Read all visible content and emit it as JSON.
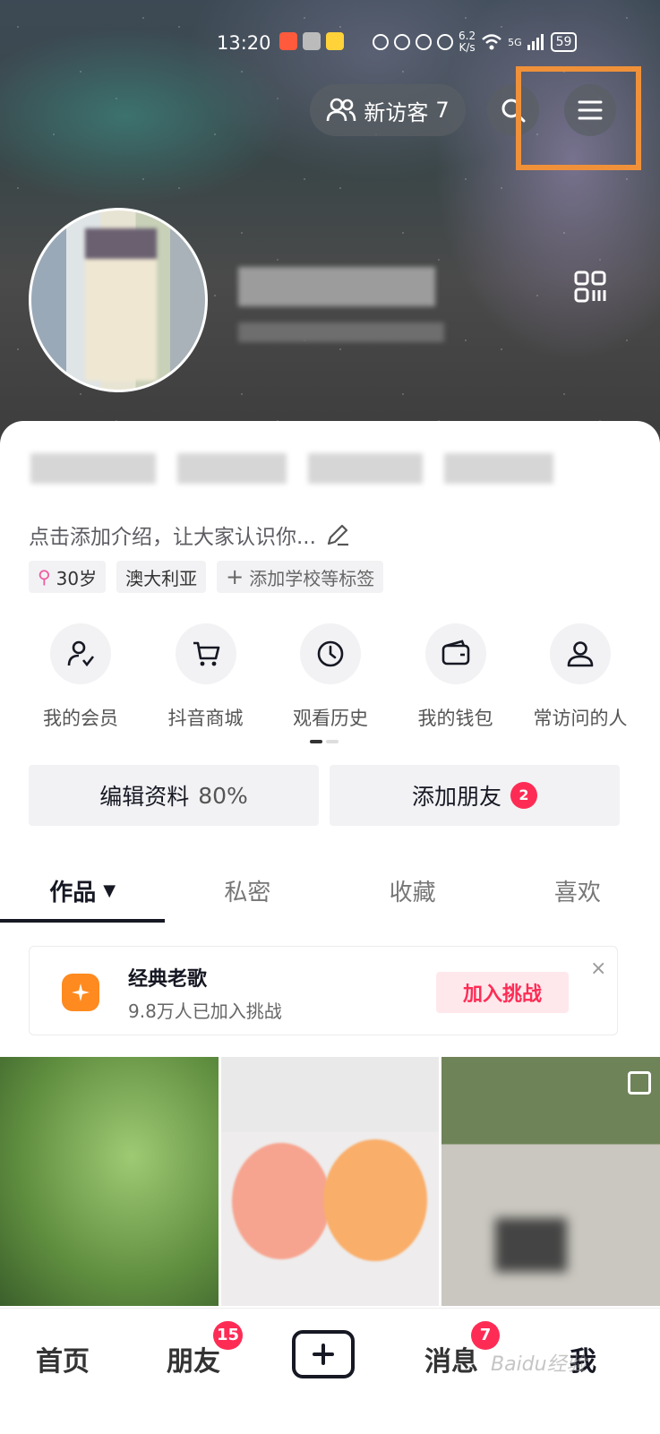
{
  "status_bar": {
    "time": "13:20",
    "net_speed_value": "6.2",
    "net_speed_unit": "K/s",
    "signal_label": "5G",
    "battery": "59"
  },
  "header": {
    "visitor_label": "新访客",
    "visitor_count": "7",
    "search_icon": "search-icon",
    "menu_icon": "menu-icon",
    "highlight_color": "#f0913a"
  },
  "profile": {
    "intro": "点击添加介绍，让大家认识你...",
    "tags": [
      {
        "text": "30岁",
        "icon": "female-icon"
      },
      {
        "text": "澳大利亚"
      },
      {
        "text": "添加学校等标签",
        "icon": "plus-icon"
      }
    ]
  },
  "shortcuts": [
    {
      "label": "我的会员",
      "icon": "member-icon"
    },
    {
      "label": "抖音商城",
      "icon": "cart-icon"
    },
    {
      "label": "观看历史",
      "icon": "clock-icon"
    },
    {
      "label": "我的钱包",
      "icon": "wallet-icon"
    },
    {
      "label": "常访问的人",
      "icon": "person-icon"
    }
  ],
  "actions": {
    "edit_label": "编辑资料",
    "edit_progress": "80%",
    "add_friend_label": "添加朋友",
    "add_friend_badge": "2"
  },
  "tabs": [
    "作品",
    "私密",
    "收藏",
    "喜欢"
  ],
  "challenge": {
    "title": "经典老歌",
    "subtitle": "9.8万人已加入挑战",
    "button": "加入挑战",
    "close": "×"
  },
  "bottom_nav": {
    "home": "首页",
    "friends": "朋友",
    "friends_badge": "15",
    "messages": "消息",
    "messages_badge": "7",
    "me": "我"
  },
  "watermark": "Baidu经验",
  "colors": {
    "accent": "#fe2c55",
    "challenge_logo": "#ff8a1f"
  }
}
